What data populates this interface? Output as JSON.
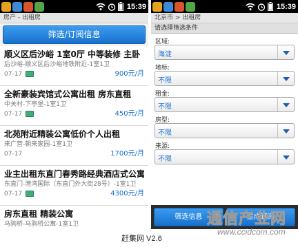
{
  "status_bar": {
    "time": "15:39",
    "app_icons": [
      "#e8a31c",
      "#3d8ad6",
      "#d9532b",
      "#52a646"
    ],
    "icons": [
      "wifi-icon",
      "alarm-icon",
      "battery-icon"
    ]
  },
  "left_screen": {
    "breadcrumb": "房产 - 出租房",
    "filter_button": "筛选/订阅信息",
    "listings": [
      {
        "title": "顺义区后沙峪 1室0厅 中等装修 主卧",
        "address": "后沙峪-顺义区后沙峪地铁附近-1室1卫",
        "date": "07-17",
        "price": "900元/月"
      },
      {
        "title": "全新豪装宾馆式公寓出租 房东直租",
        "address": "中关村-下亭堡-1室1卫",
        "date": "07-17",
        "price": "450元/月"
      },
      {
        "title": "北苑附近精装公寓低价个人出租",
        "address": "来广营-朝来家园-1室1卫",
        "date": "07-17",
        "price": "1700元/月"
      },
      {
        "title": "业主出租东直门春秀路经典酒店式公寓",
        "address": "东直门-港湾国际（东直门外大街28号）-1室1卫",
        "date": "07-17",
        "price": "4300元/月"
      },
      {
        "title": "房东直租 精装公寓",
        "address": "马驹桥-马驹桥公寓-1室1卫",
        "date": "",
        "price": ""
      }
    ]
  },
  "right_screen": {
    "breadcrumb": "北京市 > 出租房",
    "section_title": "请选择筛选条件",
    "fields": [
      {
        "label": "区域:",
        "value": "海淀"
      },
      {
        "label": "地标:",
        "value": "不限"
      },
      {
        "label": "租金:",
        "value": "不限"
      },
      {
        "label": "房型:",
        "value": "不限"
      },
      {
        "label": "来源:",
        "value": "不限"
      }
    ],
    "buttons": {
      "filter": "筛选信息",
      "subscribe": "生成订阅"
    }
  },
  "caption": "赶集网 V2.6",
  "watermark": {
    "main": "通信产业网",
    "url": "www.ccidcom.com"
  },
  "colors": {
    "accent": "#1a6fd1",
    "button_top": "#3c9cf0",
    "button_bottom": "#1770cc",
    "status_bar": "#000000"
  }
}
